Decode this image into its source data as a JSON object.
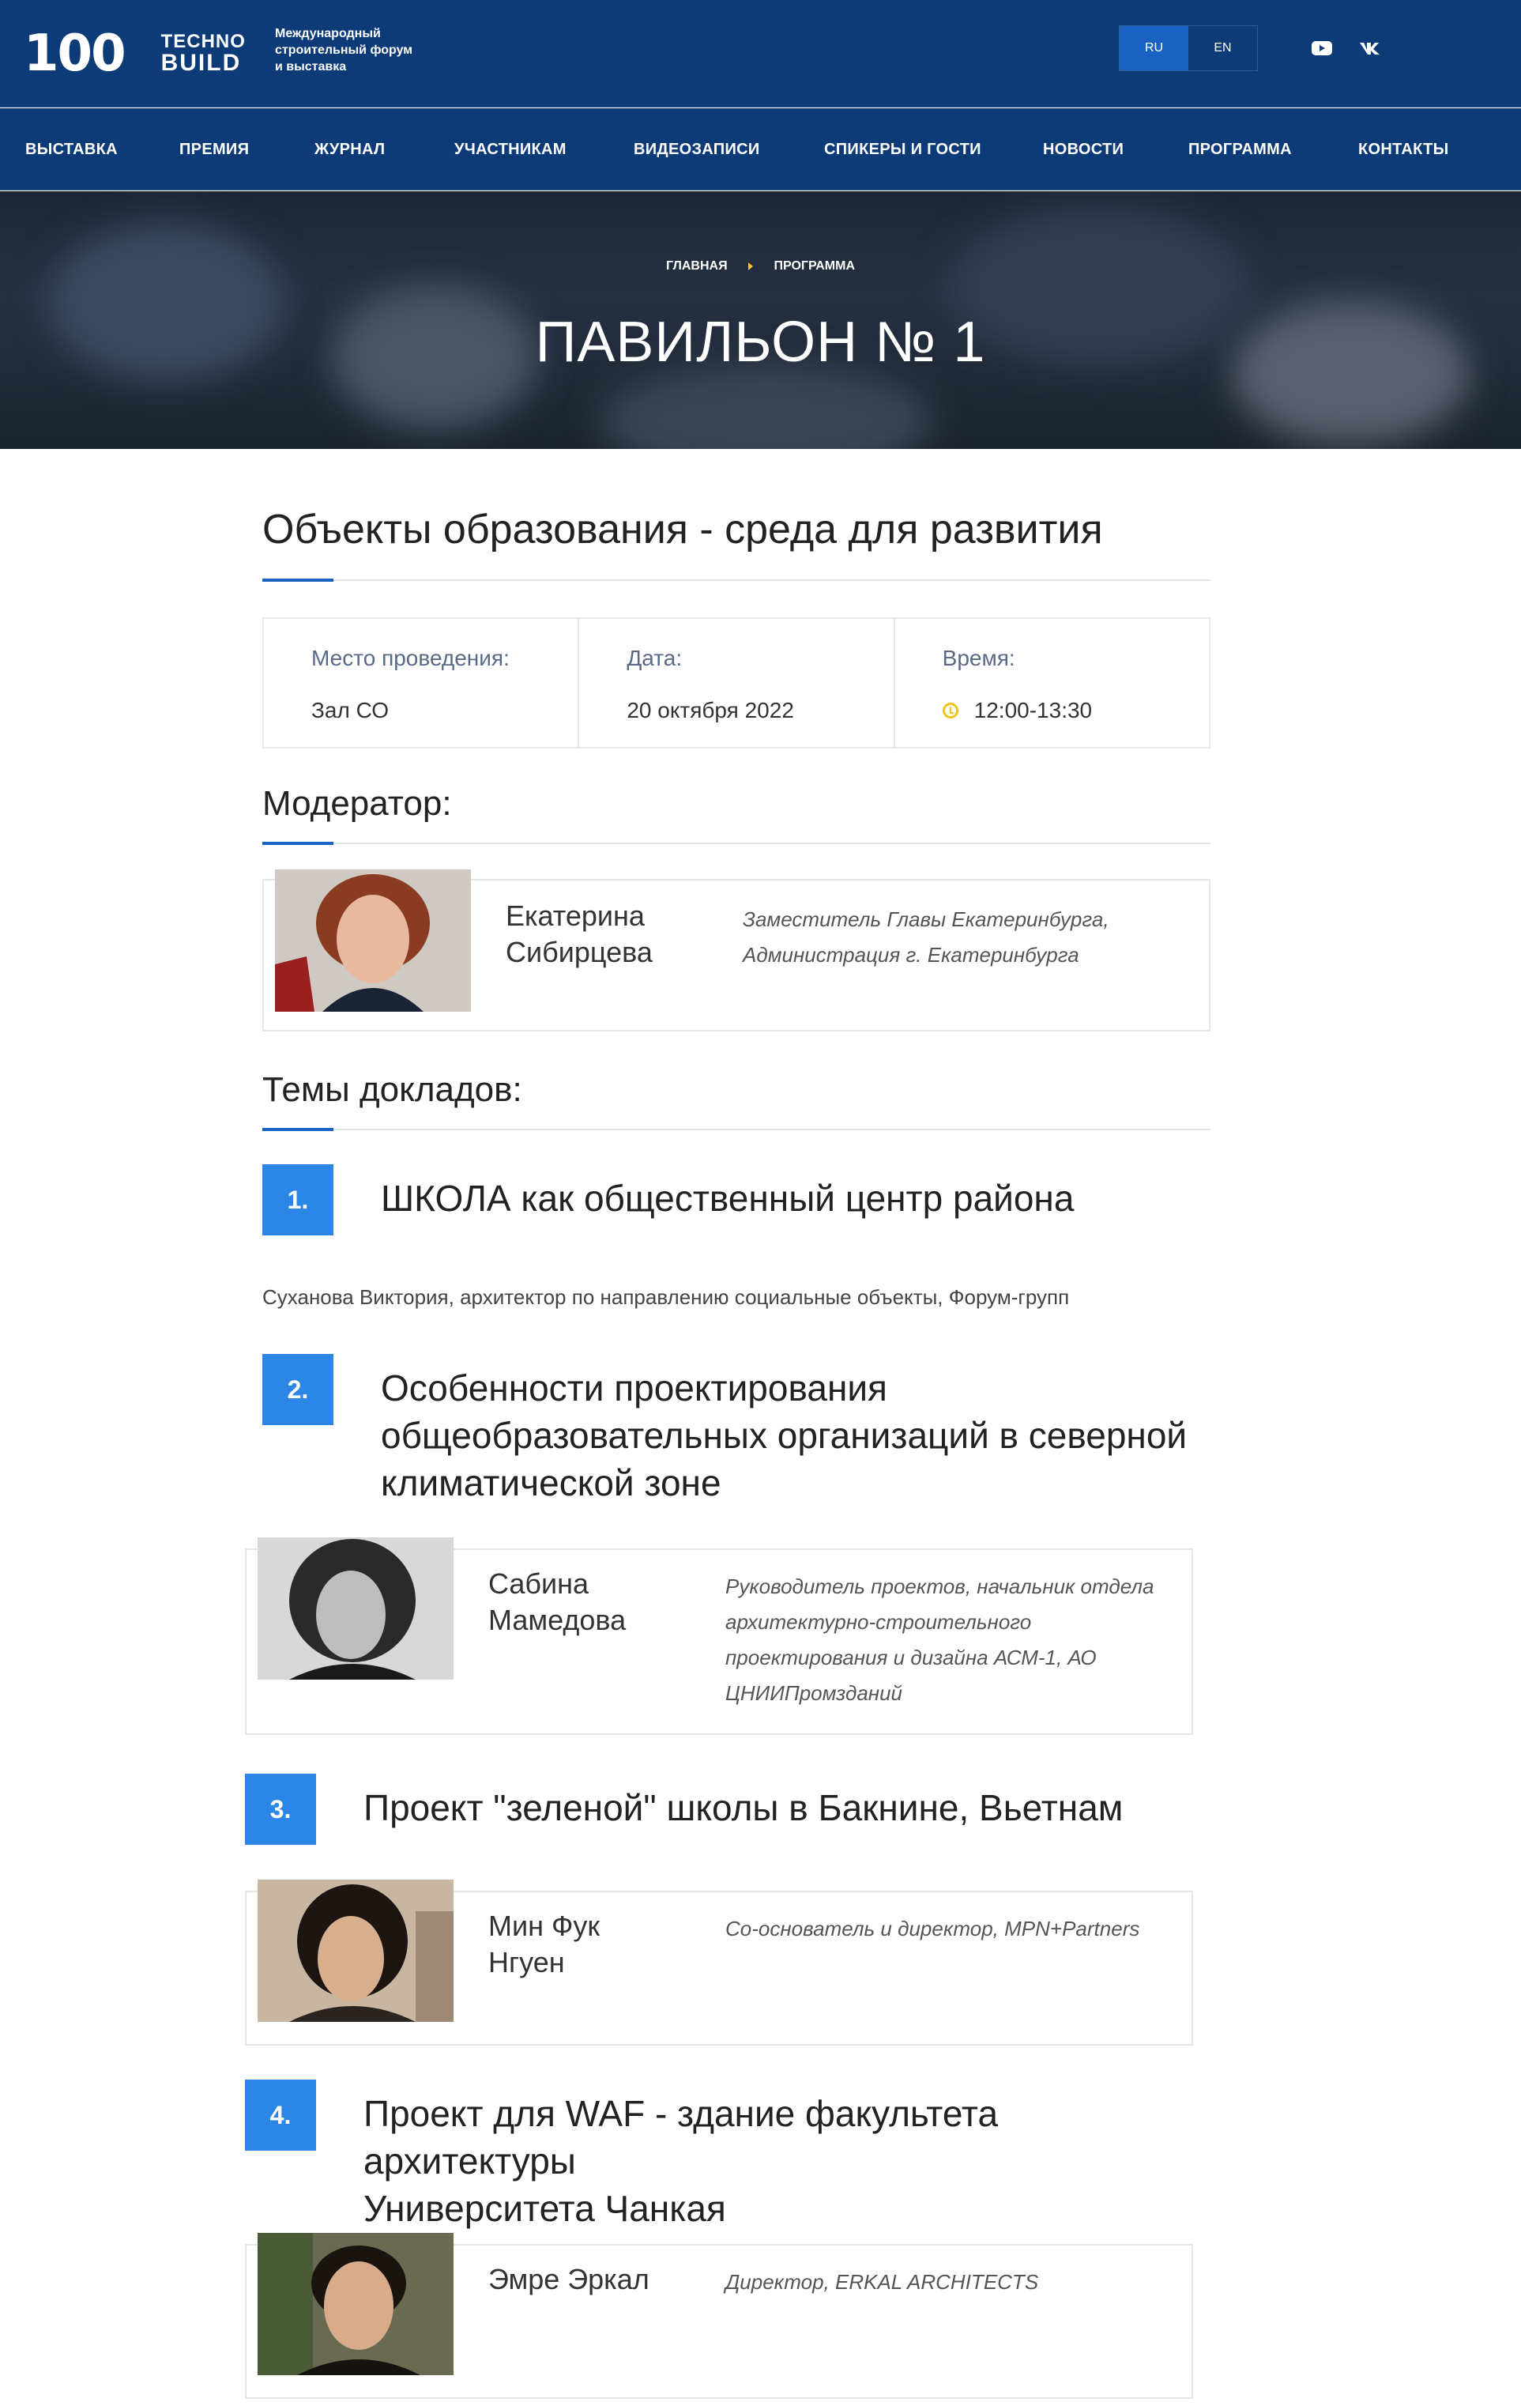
{
  "header": {
    "logo": {
      "number": "100",
      "line1": "TECHNO",
      "line2": "BUILD"
    },
    "subtitle_lines": [
      "Международный",
      "строительный форум",
      "и выставка"
    ],
    "languages": [
      {
        "label": "RU",
        "active": true
      },
      {
        "label": "EN",
        "active": false
      }
    ],
    "social": [
      "youtube-icon",
      "vk-icon"
    ]
  },
  "nav": [
    "ВЫСТАВКА",
    "ПРЕМИЯ",
    "ЖУРНАЛ",
    "УЧАСТНИКАМ",
    "ВИДЕОЗАПИСИ",
    "СПИКЕРЫ И ГОСТИ",
    "НОВОСТИ",
    "ПРОГРАММА",
    "КОНТАКТЫ"
  ],
  "breadcrumb": [
    "ГЛАВНАЯ",
    "ПРОГРАММА"
  ],
  "page_title": "ПАВИЛЬОН № 1",
  "session": {
    "title": "Объекты образования - среда для развития",
    "venue_label": "Место проведения:",
    "venue": "Зал СО",
    "date_label": "Дата:",
    "date": "20 октября 2022",
    "time_label": "Время:",
    "time": "12:00-13:30"
  },
  "moderator_heading": "Модератор:",
  "moderator": {
    "name_lines": [
      "Екатерина",
      "Сибирцева"
    ],
    "role_lines": [
      "Заместитель Главы Екатеринбурга,",
      "Администрация г. Екатеринбурга"
    ]
  },
  "topics_heading": "Темы докладов:",
  "topics": [
    {
      "number": "1.",
      "title_lines": [
        "ШКОЛА как общественный центр района"
      ],
      "author": "Суханова Виктория, архитектор по направлению социальные объекты, Форум-групп"
    },
    {
      "number": "2.",
      "title_lines": [
        "Особенности проектирования",
        "общеобразовательных организаций в северной",
        "климатической зоне"
      ],
      "speaker": {
        "name_lines": [
          "Сабина",
          "Мамедова"
        ],
        "role_lines": [
          "Руководитель проектов, начальник отдела",
          "архитектурно-строительного",
          "проектирования и дизайна АСМ-1, АО",
          "ЦНИИПромзданий"
        ]
      }
    },
    {
      "number": "3.",
      "title_lines": [
        "Проект \"зеленой\" школы в Бакнине, Вьетнам"
      ],
      "speaker": {
        "name_lines": [
          "Мин Фук",
          "Нгуен"
        ],
        "role_lines": [
          "Со-основатель и директор, MPN+Partners"
        ]
      }
    },
    {
      "number": "4.",
      "title_lines": [
        "Проект для WAF - здание факультета архитектуры",
        "Университета Чанкая"
      ],
      "speaker": {
        "name_lines": [
          "Эмре Эркал"
        ],
        "role_lines": [
          "Директор, ERKAL ARCHITECTS"
        ]
      }
    }
  ],
  "colors": {
    "header_bg": "#0d3b78",
    "accent": "#1a62c2",
    "number_badge": "#2b86e6",
    "clock": "#f0c419"
  }
}
